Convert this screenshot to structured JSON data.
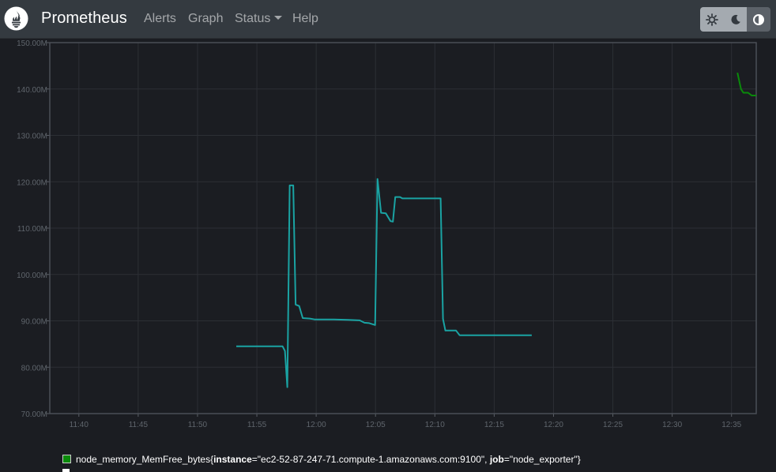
{
  "navbar": {
    "brand": "Prometheus",
    "links": {
      "alerts": "Alerts",
      "graph": "Graph",
      "status": "Status",
      "help": "Help"
    },
    "theme_buttons": [
      "light-theme",
      "dark-theme",
      "browser-default-theme"
    ],
    "active_theme": "browser-default-theme"
  },
  "chart_data": {
    "type": "line",
    "title": "",
    "xlabel": "",
    "ylabel": "",
    "grid": true,
    "x_ticks": [
      "11:40",
      "11:45",
      "11:50",
      "11:55",
      "12:00",
      "12:05",
      "12:10",
      "12:15",
      "12:20",
      "12:25",
      "12:30",
      "12:35"
    ],
    "y_ticks": [
      "70.00M",
      "80.00M",
      "90.00M",
      "100.00M",
      "110.00M",
      "120.00M",
      "130.00M",
      "140.00M",
      "150.00M"
    ],
    "ylim": [
      70,
      150
    ],
    "xlim": [
      "11:37:33",
      "12:37:05"
    ],
    "y_unit": "M",
    "series": [
      {
        "color": "#1aa3a3",
        "points": [
          [
            "11:53:16",
            84.5
          ],
          [
            "11:55:42",
            84.5
          ],
          [
            "11:57:10",
            84.5
          ],
          [
            "11:57:22",
            83.5
          ],
          [
            "11:57:34",
            75.7
          ],
          [
            "11:57:46",
            119.2
          ],
          [
            "11:58:04",
            119.2
          ],
          [
            "11:58:16",
            93.5
          ],
          [
            "11:58:34",
            93.2
          ],
          [
            "11:58:52",
            90.6
          ],
          [
            "11:59:28",
            90.5
          ],
          [
            "11:59:52",
            90.3
          ],
          [
            "12:01:28",
            90.3
          ],
          [
            "12:02:40",
            90.2
          ],
          [
            "12:03:40",
            90.1
          ],
          [
            "12:04:04",
            89.6
          ],
          [
            "12:04:28",
            89.5
          ],
          [
            "12:04:58",
            89.1
          ],
          [
            "12:05:10",
            120.6
          ],
          [
            "12:05:28",
            113.3
          ],
          [
            "12:05:52",
            113.2
          ],
          [
            "12:06:16",
            111.5
          ],
          [
            "12:06:28",
            111.4
          ],
          [
            "12:06:40",
            116.7
          ],
          [
            "12:07:04",
            116.7
          ],
          [
            "12:07:16",
            116.4
          ],
          [
            "12:10:29",
            116.4
          ],
          [
            "12:10:41",
            90.4
          ],
          [
            "12:10:53",
            87.9
          ],
          [
            "12:11:47",
            87.9
          ],
          [
            "12:12:05",
            86.9
          ],
          [
            "12:18:10",
            86.9
          ]
        ]
      },
      {
        "name": "node_memory_MemFree_bytes{instance=\"ec2-52-87-247-71.compute-1.amazonaws.com:9100\", job=\"node_exporter\"}",
        "color": "#0a8a0a",
        "points": [
          [
            "12:35:30",
            143.5
          ],
          [
            "12:35:48",
            140.0
          ],
          [
            "12:36:00",
            139.2
          ],
          [
            "12:36:24",
            139.2
          ],
          [
            "12:36:42",
            138.6
          ],
          [
            "12:37:05",
            138.6
          ]
        ]
      }
    ]
  },
  "legend": {
    "metric": "node_memory_MemFree_bytes",
    "open_brace": "{",
    "label1_key": "instance",
    "label1_value": "=\"ec2-52-87-247-71.compute-1.amazonaws.com:9100\", ",
    "label2_key": "job",
    "label2_value": "=\"node_exporter\"}",
    "swatch_color": "#0a8a0a"
  }
}
